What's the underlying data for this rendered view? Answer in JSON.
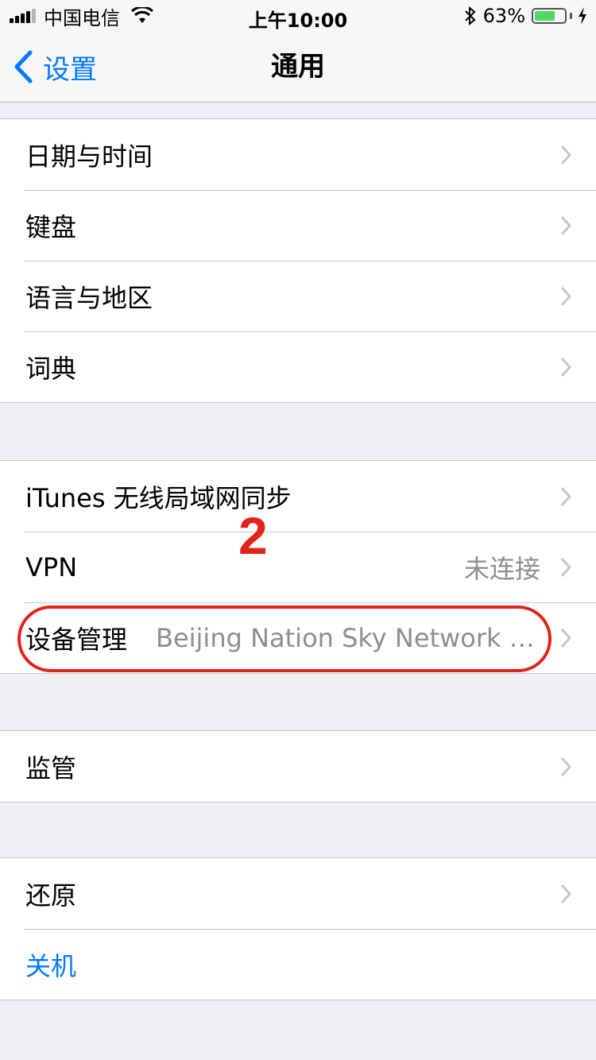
{
  "status_bar": {
    "carrier": "中国电信",
    "time": "上午10:00",
    "battery_percent": "63%",
    "battery_level": 0.63,
    "icons": [
      "signal-icon",
      "wifi-icon",
      "bluetooth-icon",
      "battery-icon",
      "charging-icon"
    ]
  },
  "nav": {
    "back_label": "设置",
    "title": "通用"
  },
  "groups": [
    {
      "items": [
        {
          "label": "日期与时间"
        },
        {
          "label": "键盘"
        },
        {
          "label": "语言与地区"
        },
        {
          "label": "词典"
        }
      ]
    },
    {
      "items": [
        {
          "label": "iTunes 无线局域网同步"
        },
        {
          "label": "VPN",
          "detail": "未连接"
        },
        {
          "label": "设备管理",
          "detail": "Beijing Nation Sky Network Te..."
        }
      ]
    },
    {
      "items": [
        {
          "label": "监管"
        }
      ]
    },
    {
      "items": [
        {
          "label": "还原"
        },
        {
          "label": "关机"
        }
      ]
    }
  ],
  "annotation": {
    "number": "2",
    "color": "#e1231c"
  },
  "colors": {
    "accent": "#007aff",
    "background": "#efeff4",
    "detail_text": "#8e8e93"
  }
}
